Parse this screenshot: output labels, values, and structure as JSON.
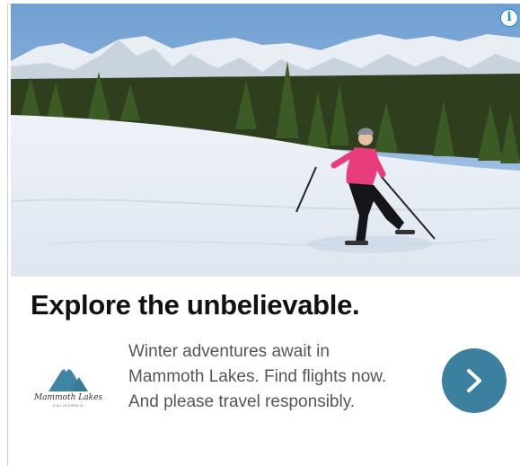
{
  "ad": {
    "headline": "Explore the unbelievable.",
    "body_lines": [
      "Winter adventures await in",
      "Mammoth Lakes. Find flights now.",
      "And please travel responsibly."
    ],
    "info_icon": {
      "glyph": "i",
      "icon": "info-icon",
      "color": "#1a86c8"
    },
    "cta": {
      "icon": "chevron-right-icon",
      "color": "#3c80a0"
    },
    "logo": {
      "text": "Mammoth Lakes",
      "subtext": "CALIFORNIA",
      "mountain_color": "#3f86a4"
    },
    "hero_image": {
      "subject": "snowshoer-in-pink-jacket-on-snowy-meadow"
    }
  }
}
